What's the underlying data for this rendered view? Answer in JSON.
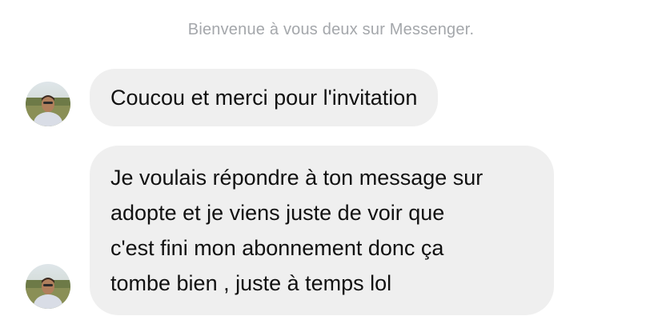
{
  "conversation": {
    "system_note": "Bienvenue à vous deux sur Messenger.",
    "messages": [
      {
        "lines": [
          "Coucou et merci pour l'invitation"
        ]
      },
      {
        "lines": [
          "Je voulais répondre à ton message sur",
          "adopte et je viens juste de voir que",
          "c'est fini mon abonnement donc ça",
          "tombe bien , juste à temps lol"
        ]
      }
    ]
  },
  "colors": {
    "bubble_background": "#efefef",
    "system_note_text": "#a4a7ab",
    "message_text": "#111111"
  }
}
